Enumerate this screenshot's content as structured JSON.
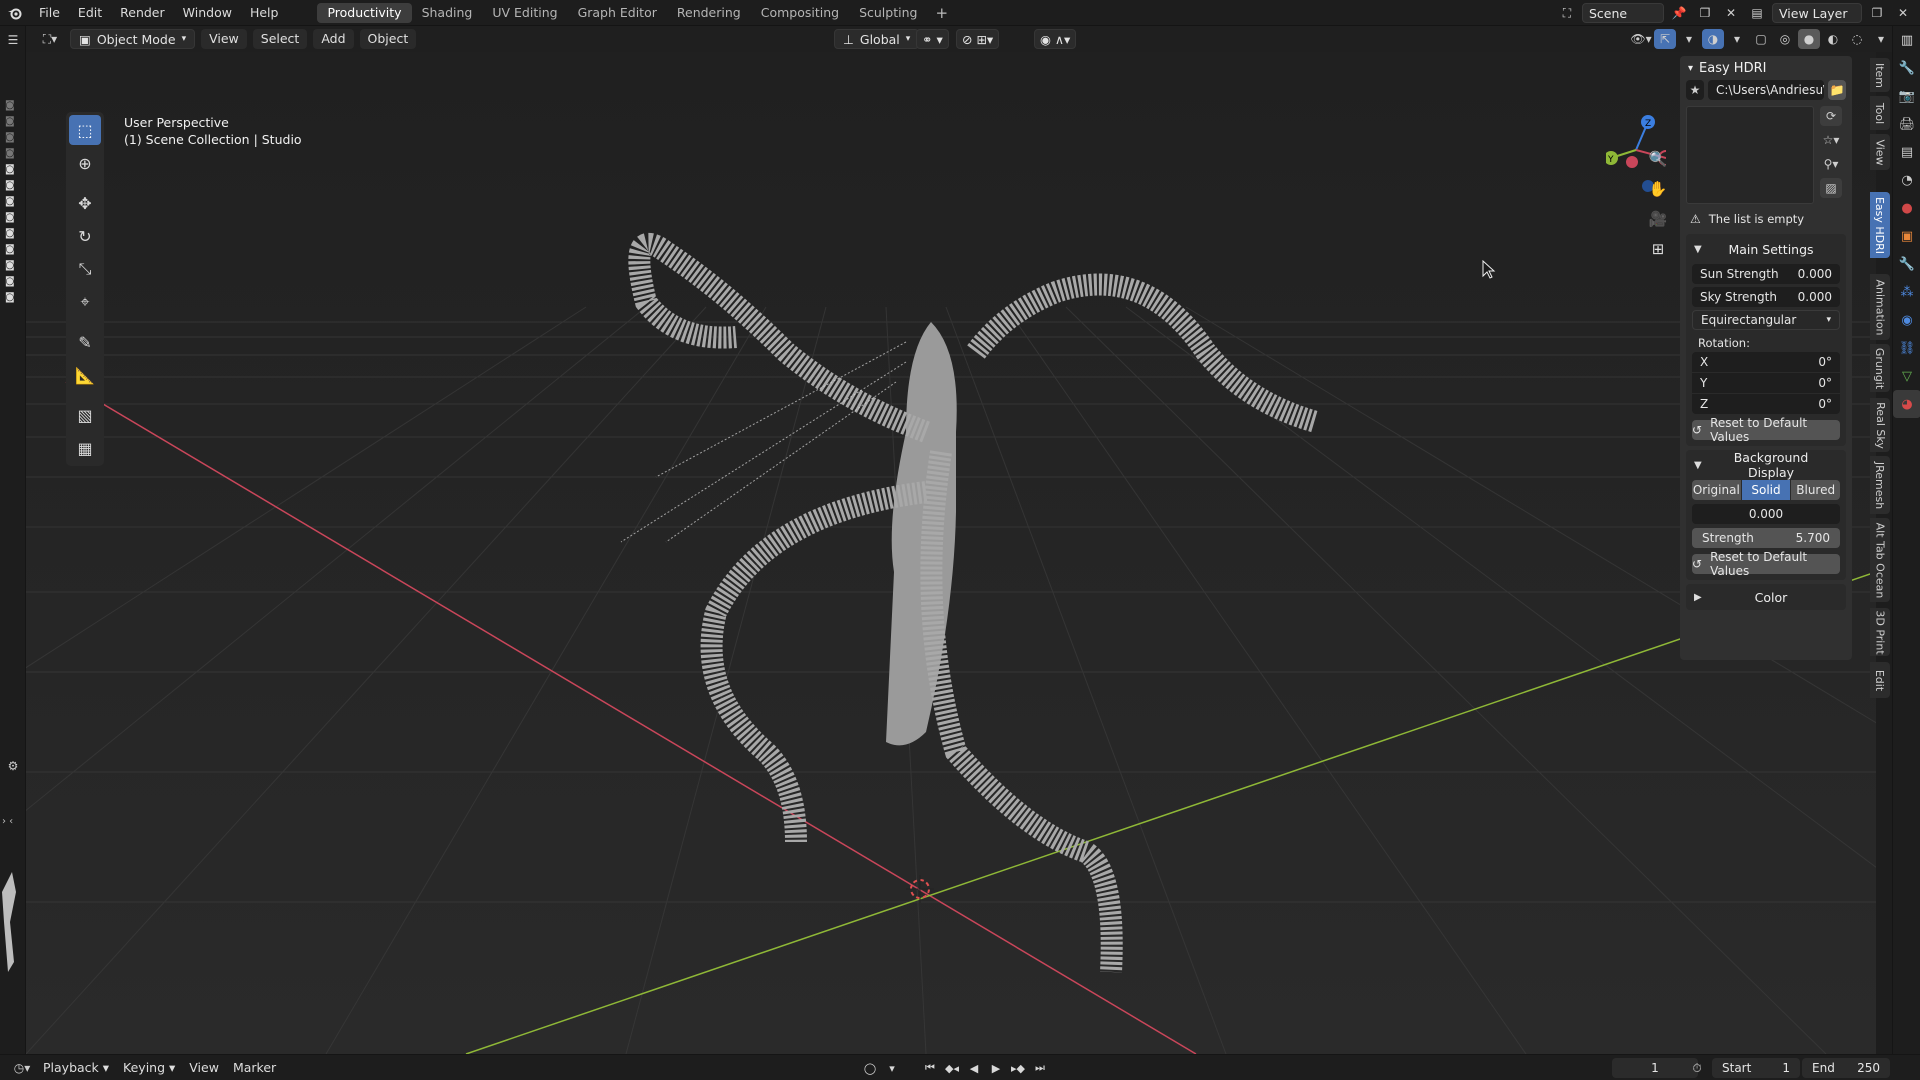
{
  "topbar": {
    "menus": [
      "File",
      "Edit",
      "Render",
      "Window",
      "Help"
    ],
    "workspaces": [
      "Productivity",
      "Shading",
      "UV Editing",
      "Graph Editor",
      "Rendering",
      "Compositing",
      "Sculpting"
    ],
    "active_workspace": "Productivity",
    "scene": "Scene",
    "view_layer": "View Layer"
  },
  "header": {
    "mode": "Object Mode",
    "menus": [
      "View",
      "Select",
      "Add",
      "Object"
    ],
    "orientation": "Global"
  },
  "viewport": {
    "title": "User Perspective",
    "collection": "(1) Scene Collection | Studio"
  },
  "npanel": {
    "title": "Easy HDRI",
    "path": "C:\\Users\\Andriesu\\...",
    "empty_msg": "The list is empty",
    "main_settings": {
      "label": "Main Settings",
      "sun_strength_label": "Sun Strength",
      "sun_strength": "0.000",
      "sky_strength_label": "Sky Strength",
      "sky_strength": "0.000",
      "projection": "Equirectangular",
      "rotation_label": "Rotation:",
      "x_label": "X",
      "x": "0°",
      "y_label": "Y",
      "y": "0°",
      "z_label": "Z",
      "z": "0°",
      "reset": "Reset to Default Values"
    },
    "background_display": {
      "label": "Background Display",
      "options": [
        "Original",
        "Solid",
        "Blured"
      ],
      "selected": "Solid",
      "value": "0.000",
      "strength_label": "Strength",
      "strength": "5.700",
      "reset": "Reset to Default Values"
    },
    "color_label": "Color"
  },
  "side_tabs": [
    "Item",
    "Tool",
    "View",
    "Easy HDRI",
    "Animation",
    "Grungit",
    "Real Sky",
    "JRemesh",
    "Alt Tab Ocean",
    "3D Print",
    "Edit"
  ],
  "active_side_tab": "Easy HDRI",
  "timeline": {
    "menus": [
      "Playback",
      "Keying",
      "View",
      "Marker"
    ],
    "current_frame": "1",
    "start_label": "Start",
    "start": "1",
    "end_label": "End",
    "end": "250"
  },
  "colors": {
    "accent": "#4772b3",
    "x_axis": "#c9465a",
    "y_axis": "#8fb837",
    "z_axis": "#3b7ee0"
  }
}
